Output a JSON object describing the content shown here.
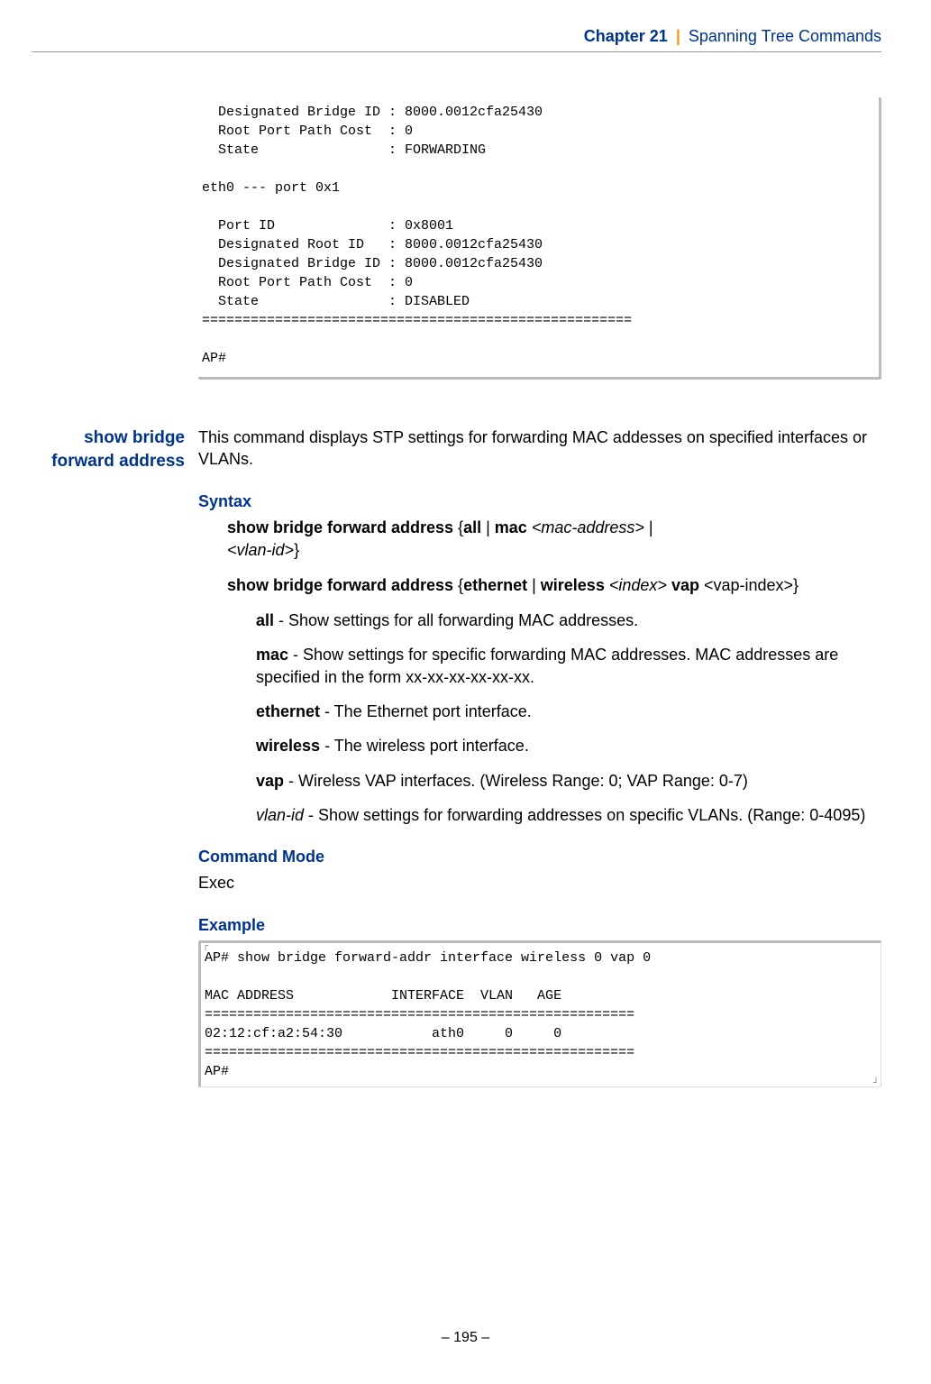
{
  "header": {
    "chapter_strong": "Chapter 21",
    "bar": "|",
    "chapter_light": "Spanning Tree Commands"
  },
  "code_top": "  Designated Bridge ID : 8000.0012cfa25430\n  Root Port Path Cost  : 0\n  State                : FORWARDING\n\neth0 --- port 0x1\n\n  Port ID              : 0x8001\n  Designated Root ID   : 8000.0012cfa25430\n  Designated Bridge ID : 8000.0012cfa25430\n  Root Port Path Cost  : 0\n  State                : DISABLED\n=====================================================\n\nAP#",
  "section": {
    "left_heading": "show bridge forward address",
    "intro": "This command displays STP settings for forwarding MAC addesses on specified interfaces or VLANs.",
    "syntax_label": "Syntax",
    "syntax1_parts": {
      "cmd": "show bridge forward address",
      "brace_open": " {",
      "all": "all",
      "pipe1": " | ",
      "mac": "mac",
      "sp1": " ",
      "macarg": "<mac-address>",
      "pipe2": " |",
      "vlanarg": "<vlan-id>",
      "brace_close": "}"
    },
    "syntax2_parts": {
      "cmd": "show bridge forward address",
      "brace_open": " {",
      "eth": "ethernet",
      "pipe1": " | ",
      "wl": "wireless",
      "sp1": " ",
      "idx": "<index>",
      "sp2": " ",
      "vap": "vap",
      "sp3": " <",
      "vapidx": "vap-index",
      "brace_close": ">}"
    },
    "params": {
      "p1b": "all",
      "p1": " - Show settings for all forwarding MAC addresses.",
      "p2b": "mac",
      "p2": " - Show settings for specific forwarding MAC addresses. MAC addresses are specified in the form xx-xx-xx-xx-xx-xx.",
      "p3b": "ethernet",
      "p3": " - The Ethernet port interface.",
      "p4b": "wireless",
      "p4": " - The wireless port interface.",
      "p5b": "vap",
      "p5": "  - Wireless VAP interfaces. (Wireless Range: 0; VAP Range: 0-7)",
      "p6i": "vlan-id",
      "p6": " - Show settings for forwarding addresses on specific VLANs. (Range: 0-4095)"
    },
    "cmdmode_label": "Command Mode",
    "cmdmode_value": "Exec",
    "example_label": "Example"
  },
  "code_bottom": "AP# show bridge forward-addr interface wireless 0 vap 0\n\nMAC ADDRESS            INTERFACE  VLAN   AGE\n=====================================================\n02:12:cf:a2:54:30           ath0     0     0\n=====================================================\nAP#",
  "footer": "–  195  –"
}
